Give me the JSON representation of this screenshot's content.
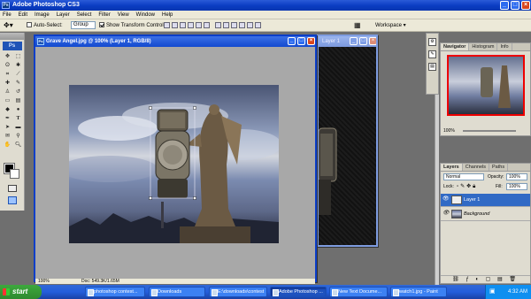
{
  "app": {
    "title": "Adobe Photoshop CS3",
    "logo": "Ps"
  },
  "menu": [
    "File",
    "Edit",
    "Image",
    "Layer",
    "Select",
    "Filter",
    "View",
    "Window",
    "Help"
  ],
  "options": {
    "auto_select_label": "Auto-Select:",
    "auto_select_value": "Group",
    "show_transform_label": "Show Transform Controls",
    "workspace_label": "Workspace"
  },
  "document": {
    "title": "Grave Angel.jpg @ 100% (Layer 1, RGB/8)",
    "zoom": "100%",
    "doc_info": "Doc: 549.3K/1.65M"
  },
  "document2": {
    "title": "Layer 1"
  },
  "navigator": {
    "tabs": [
      "Navigator",
      "Histogram",
      "Info"
    ],
    "zoom": "100%"
  },
  "layers_panel": {
    "tabs": [
      "Layers",
      "Channels",
      "Paths"
    ],
    "blend_mode": "Normal",
    "opacity_label": "Opacity:",
    "opacity": "100%",
    "lock_label": "Lock:",
    "fill_label": "Fill:",
    "fill": "100%",
    "layers": [
      "Layer 1",
      "Background"
    ]
  },
  "taskbar": {
    "start": "start",
    "buttons": [
      "photoshop contest...",
      "Downloads",
      "E:\\downloads\\contest",
      "Adobe Photoshop ...",
      "New Text Docume...",
      "watch1.jpg - Paint"
    ],
    "clock": "4:32 AM"
  },
  "colors": {
    "title_blue": "#0a3cc2",
    "taskbar_blue": "#245edb",
    "start_green": "#3da83d",
    "selected_layer": "#316ac5"
  }
}
